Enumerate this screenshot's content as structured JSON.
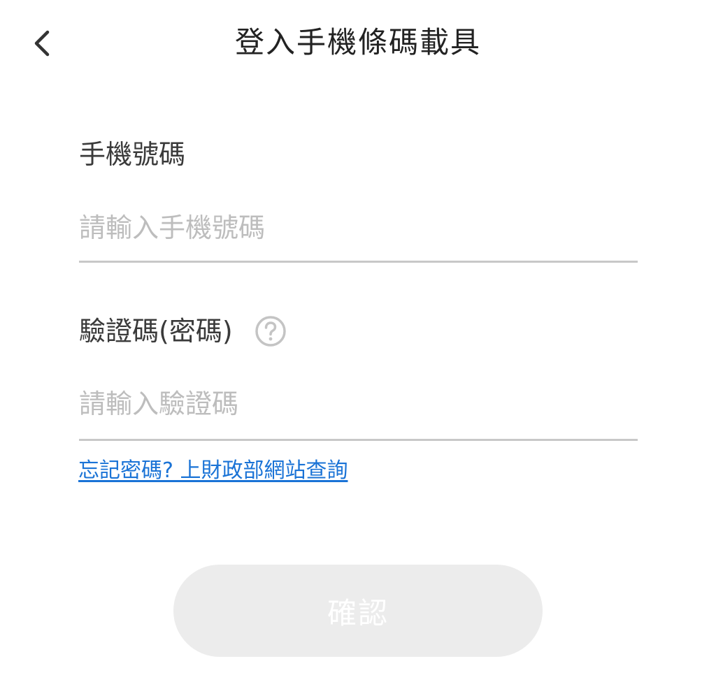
{
  "header": {
    "title": "登入手機條碼載具",
    "back_icon": "chevron-left-icon"
  },
  "phone": {
    "label": "手機號碼",
    "placeholder": "請輸入手機號碼",
    "value": ""
  },
  "code": {
    "label": "驗證碼(密碼)",
    "placeholder": "請輸入驗證碼",
    "value": "",
    "help_icon": "question-circle-icon"
  },
  "forgot": {
    "label": "忘記密碼? 上財政部網站查詢"
  },
  "confirm": {
    "label": "確認"
  },
  "colors": {
    "link": "#1a73d6",
    "button_disabled_bg": "#ececec",
    "placeholder": "#bdbdbd",
    "underline": "#c8c8c8"
  }
}
